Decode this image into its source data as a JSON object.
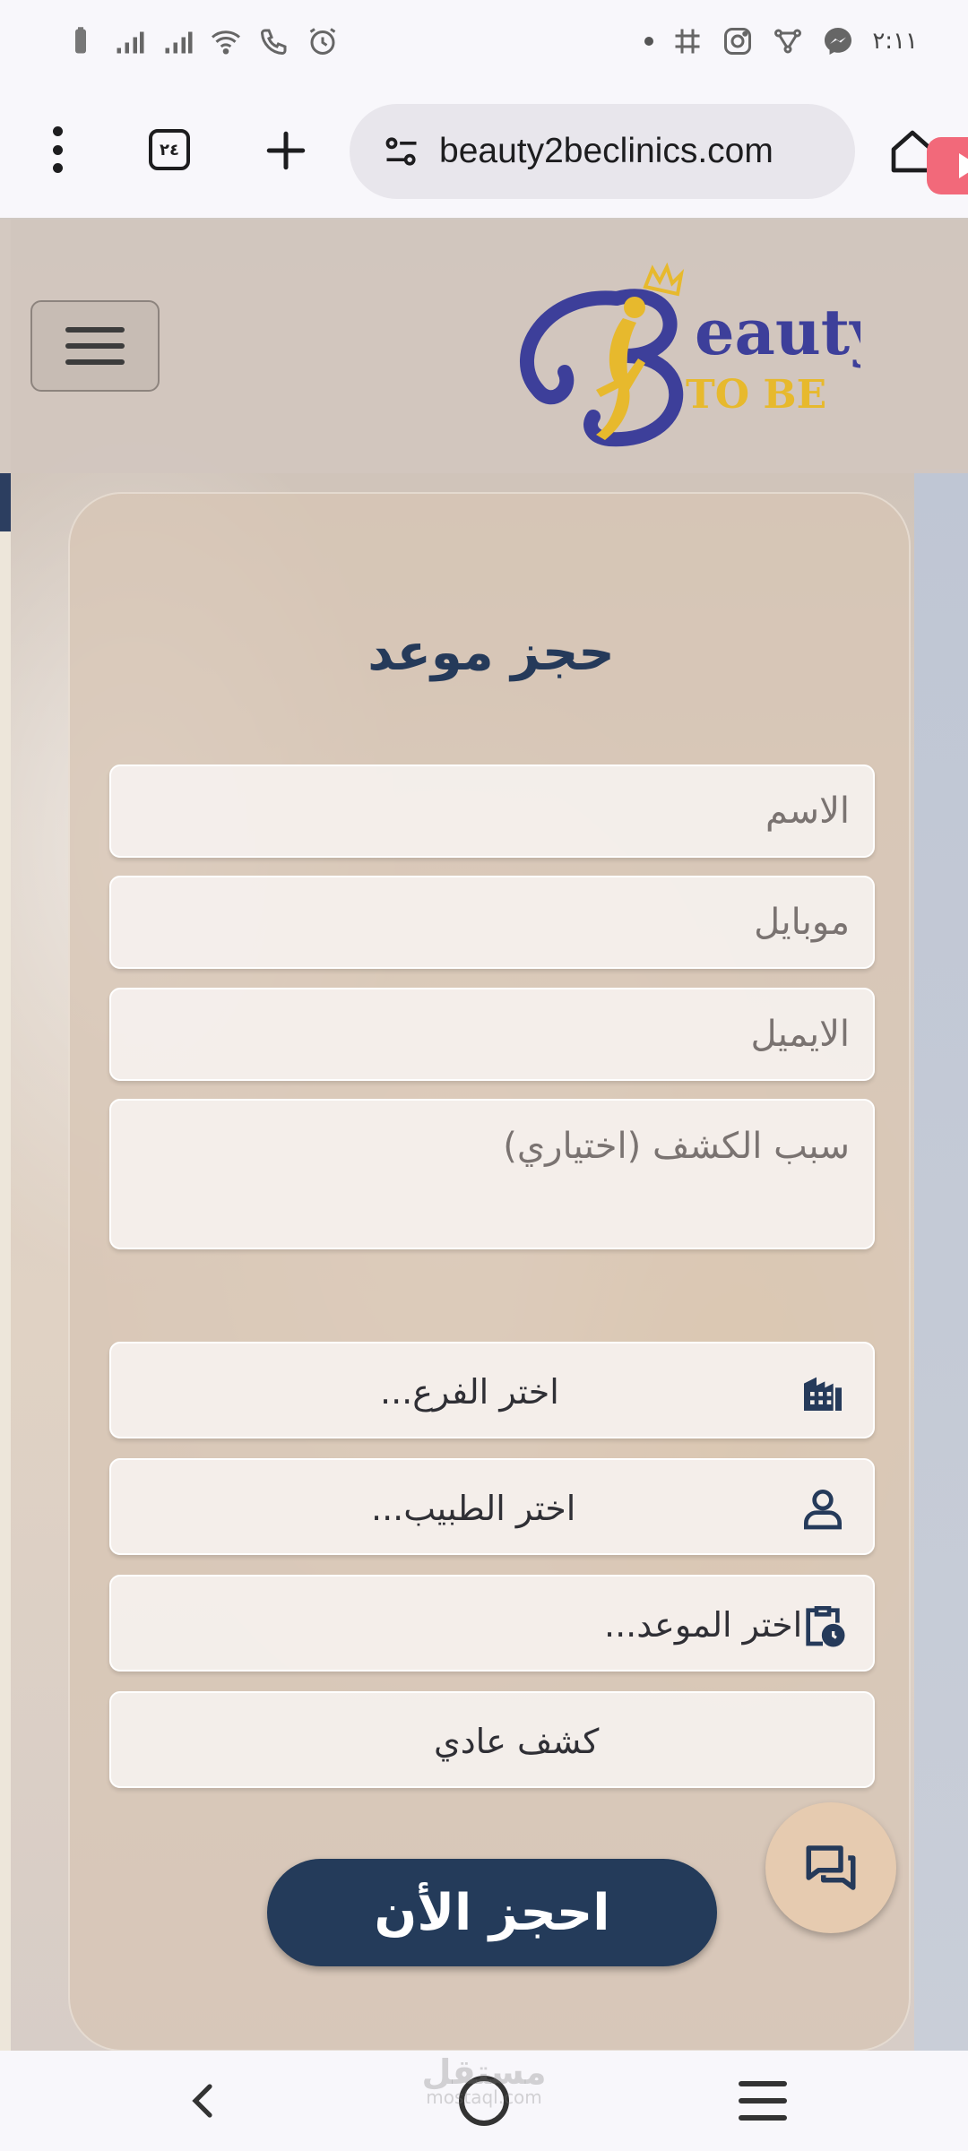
{
  "status_bar": {
    "time": "٢:١١",
    "left_icons": [
      "battery-icon",
      "signal-icon",
      "signal-icon",
      "wifi-icon",
      "wifi-calling-icon",
      "alarm-icon"
    ],
    "right_icons": [
      "notification-dot-icon",
      "grid-icon",
      "instagram-icon",
      "network-icon",
      "messenger-icon"
    ]
  },
  "browser": {
    "tab_count": "٢٤",
    "url": "beauty2beclinics.com"
  },
  "header": {
    "logo_text_main": "eauty",
    "logo_text_sub": "TO BE"
  },
  "form": {
    "title": "حجز موعد",
    "name_placeholder": "الاسم",
    "mobile_placeholder": "موبايل",
    "email_placeholder": "الايميل",
    "reason_placeholder": "سبب الكشف (اختياري)",
    "branch_label": "اختر الفرع...",
    "doctor_label": "اختر الطبيب...",
    "appointment_label": "اختر الموعد...",
    "visit_type_label": "كشف عادي",
    "submit_label": "احجز الأن"
  },
  "watermark": {
    "text": "مستقل",
    "sub": "mostaql.com"
  },
  "colors": {
    "primary": "#243b5a",
    "logo_blue": "#3d3f9a",
    "logo_gold": "#e7b92d",
    "chat_fab": "#e6cbb0"
  }
}
